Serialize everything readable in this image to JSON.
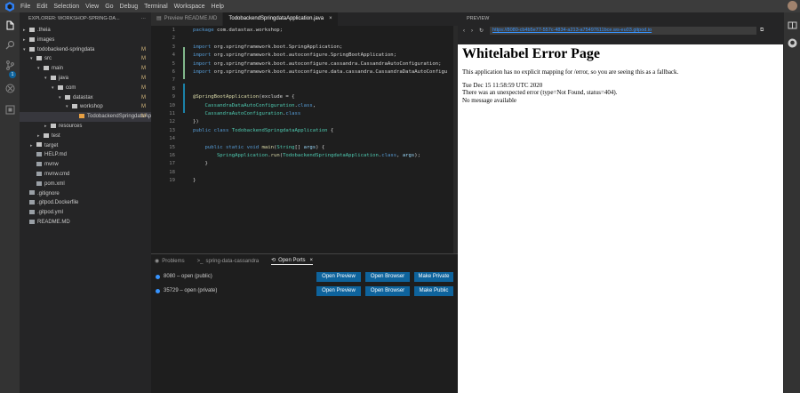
{
  "menu": {
    "items": [
      "File",
      "Edit",
      "Selection",
      "View",
      "Go",
      "Debug",
      "Terminal",
      "Workspace",
      "Help"
    ]
  },
  "sidebar": {
    "title": "EXPLORER: WORKSHOP-SPRING-DA...",
    "items": [
      {
        "label": ".theia",
        "indent": 1,
        "kind": "folder",
        "open": false,
        "status": ""
      },
      {
        "label": "images",
        "indent": 1,
        "kind": "folder",
        "open": false,
        "status": ""
      },
      {
        "label": "todobackend-springdata",
        "indent": 1,
        "kind": "folder",
        "open": true,
        "status": "M"
      },
      {
        "label": "src",
        "indent": 2,
        "kind": "folder",
        "open": true,
        "status": "M"
      },
      {
        "label": "main",
        "indent": 3,
        "kind": "folder",
        "open": true,
        "status": "M"
      },
      {
        "label": "java",
        "indent": 4,
        "kind": "folder",
        "open": true,
        "status": "M"
      },
      {
        "label": "com",
        "indent": 5,
        "kind": "folder",
        "open": true,
        "status": "M"
      },
      {
        "label": "datastax",
        "indent": 6,
        "kind": "folder",
        "open": true,
        "status": "M"
      },
      {
        "label": "workshop",
        "indent": 7,
        "kind": "folder",
        "open": true,
        "status": "M"
      },
      {
        "label": "TodobackendSpringdataAppli...",
        "indent": 8,
        "kind": "file",
        "open": false,
        "status": "M"
      },
      {
        "label": "resources",
        "indent": 4,
        "kind": "folder",
        "open": false,
        "status": ""
      },
      {
        "label": "test",
        "indent": 3,
        "kind": "folder",
        "open": false,
        "status": ""
      },
      {
        "label": "target",
        "indent": 2,
        "kind": "folder",
        "open": false,
        "status": ""
      },
      {
        "label": "HELP.md",
        "indent": 2,
        "kind": "file",
        "open": false,
        "status": ""
      },
      {
        "label": "mvnw",
        "indent": 2,
        "kind": "file",
        "open": false,
        "status": ""
      },
      {
        "label": "mvnw.cmd",
        "indent": 2,
        "kind": "file",
        "open": false,
        "status": ""
      },
      {
        "label": "pom.xml",
        "indent": 2,
        "kind": "file",
        "open": false,
        "status": ""
      },
      {
        "label": ".gitignore",
        "indent": 1,
        "kind": "file",
        "open": false,
        "status": ""
      },
      {
        "label": ".gitpod.Dockerfile",
        "indent": 1,
        "kind": "file",
        "open": false,
        "status": ""
      },
      {
        "label": ".gitpod.yml",
        "indent": 1,
        "kind": "file",
        "open": false,
        "status": ""
      },
      {
        "label": "README.MD",
        "indent": 1,
        "kind": "file",
        "open": false,
        "status": ""
      }
    ]
  },
  "activity": {
    "scm_badge": "1"
  },
  "tabs": [
    {
      "label": "Preview README.MD",
      "active": false
    },
    {
      "label": "TodobackendSpringdataApplication.java",
      "active": true
    }
  ],
  "editor": {
    "line_numbers": [
      "1",
      "2",
      "3",
      "4",
      "5",
      "6",
      "7",
      "8",
      "9",
      "10",
      "11",
      "12",
      "13",
      "14",
      "15",
      "16",
      "17",
      "18",
      "19"
    ],
    "lines": [
      [
        {
          "t": "package ",
          "c": "kw"
        },
        {
          "t": "com.datastax.workshop;",
          "c": ""
        }
      ],
      [],
      [
        {
          "t": "import ",
          "c": "kw"
        },
        {
          "t": "org.springframework.boot.SpringApplication;",
          "c": ""
        }
      ],
      [
        {
          "t": "import ",
          "c": "kw"
        },
        {
          "t": "org.springframework.boot.autoconfigure.SpringBootApplication;",
          "c": ""
        }
      ],
      [
        {
          "t": "import ",
          "c": "kw"
        },
        {
          "t": "org.springframework.boot.autoconfigure.cassandra.CassandraAutoConfiguration;",
          "c": ""
        }
      ],
      [
        {
          "t": "import ",
          "c": "kw"
        },
        {
          "t": "org.springframework.boot.autoconfigure.data.cassandra.CassandraDataAutoConfigu",
          "c": ""
        }
      ],
      [],
      [],
      [
        {
          "t": "@SpringBootApplication",
          "c": "an"
        },
        {
          "t": "(exclude = {",
          "c": ""
        }
      ],
      [
        {
          "t": "    CassandraDataAutoConfiguration",
          "c": "ty"
        },
        {
          "t": ".",
          "c": ""
        },
        {
          "t": "class",
          "c": "kw"
        },
        {
          "t": ",",
          "c": ""
        }
      ],
      [
        {
          "t": "    CassandraAutoConfiguration",
          "c": "ty"
        },
        {
          "t": ".",
          "c": ""
        },
        {
          "t": "class",
          "c": "kw"
        }
      ],
      [
        {
          "t": "})",
          "c": ""
        }
      ],
      [
        {
          "t": "public class ",
          "c": "kw"
        },
        {
          "t": "TodobackendSpringdataApplication",
          "c": "ty"
        },
        {
          "t": " {",
          "c": ""
        }
      ],
      [],
      [
        {
          "t": "    public static void ",
          "c": "kw"
        },
        {
          "t": "main",
          "c": "an"
        },
        {
          "t": "(",
          "c": ""
        },
        {
          "t": "String",
          "c": "ty"
        },
        {
          "t": "[] ",
          "c": ""
        },
        {
          "t": "args",
          "c": "vr"
        },
        {
          "t": ") {",
          "c": ""
        }
      ],
      [
        {
          "t": "        SpringApplication",
          "c": "ty"
        },
        {
          "t": ".",
          "c": ""
        },
        {
          "t": "run",
          "c": "an"
        },
        {
          "t": "(",
          "c": ""
        },
        {
          "t": "TodobackendSpringdataApplication",
          "c": "ty"
        },
        {
          "t": ".",
          "c": ""
        },
        {
          "t": "class",
          "c": "kw"
        },
        {
          "t": ", ",
          "c": ""
        },
        {
          "t": "args",
          "c": "vr"
        },
        {
          "t": ");",
          "c": ""
        }
      ],
      [
        {
          "t": "    }",
          "c": ""
        }
      ],
      [],
      [
        {
          "t": "}",
          "c": ""
        }
      ]
    ]
  },
  "panel": {
    "tabs": [
      {
        "label": "Problems",
        "active": false
      },
      {
        "label": "spring-data-cassandra",
        "active": false
      },
      {
        "label": "Open Ports",
        "active": true
      }
    ],
    "ports": [
      {
        "label": "8080 – open (public)",
        "buttons": [
          "Open Preview",
          "Open Browser",
          "Make Private"
        ]
      },
      {
        "label": "35729 – open (private)",
        "buttons": [
          "Open Preview",
          "Open Browser",
          "Make Public"
        ]
      }
    ]
  },
  "preview": {
    "header": "PREVIEW",
    "url": "https://8080-cb4b5e77-557c-4834-a213-a75497611bce.ws-eu03.gitpod.io",
    "title": "Whitelabel Error Page",
    "message": "This application has no explicit mapping for /error, so you are seeing this as a fallback.",
    "timestamp": "Tue Dec 15 11:58:59 UTC 2020",
    "error_line": "There was an unexpected error (type=Not Found, status=404).",
    "detail": "No message available"
  },
  "colors": {
    "accent": "#0e639c",
    "modified": "#d7ba7d",
    "link": "#3794ff"
  }
}
